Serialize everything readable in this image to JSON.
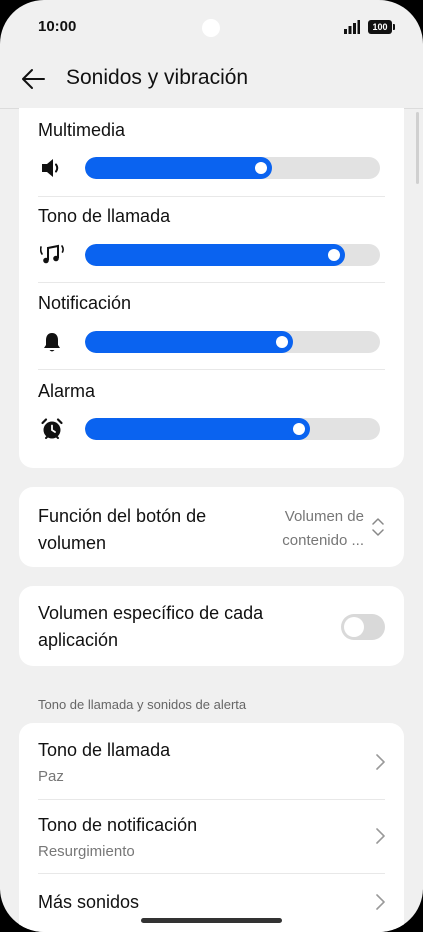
{
  "status": {
    "time": "10:00",
    "battery": "100"
  },
  "header": {
    "title": "Sonidos y vibración"
  },
  "volume": {
    "items": [
      {
        "label": "Multimedia",
        "icon": "speaker-icon",
        "level": 0.6325
      },
      {
        "label": "Tono de llamada",
        "icon": "ringtone-icon",
        "level": 0.88
      },
      {
        "label": "Notificación",
        "icon": "bell-icon",
        "level": 0.7042
      },
      {
        "label": "Alarma",
        "icon": "alarm-clock-icon",
        "level": 0.7615
      }
    ]
  },
  "volume_button": {
    "label": "Función del botón de volumen",
    "value": "Volumen de contenido ..."
  },
  "app_volume": {
    "label": "Volumen específico de cada aplicación",
    "enabled": false
  },
  "ringtones": {
    "section_title": "Tono de llamada y sonidos de alerta",
    "items": [
      {
        "title": "Tono de llamada",
        "subtitle": "Paz"
      },
      {
        "title": "Tono de notificación",
        "subtitle": "Resurgimiento"
      },
      {
        "title": "Más sonidos",
        "subtitle": ""
      }
    ]
  },
  "colors": {
    "accent": "#0a63f0",
    "background": "#f0f0f0",
    "card": "#ffffff"
  }
}
